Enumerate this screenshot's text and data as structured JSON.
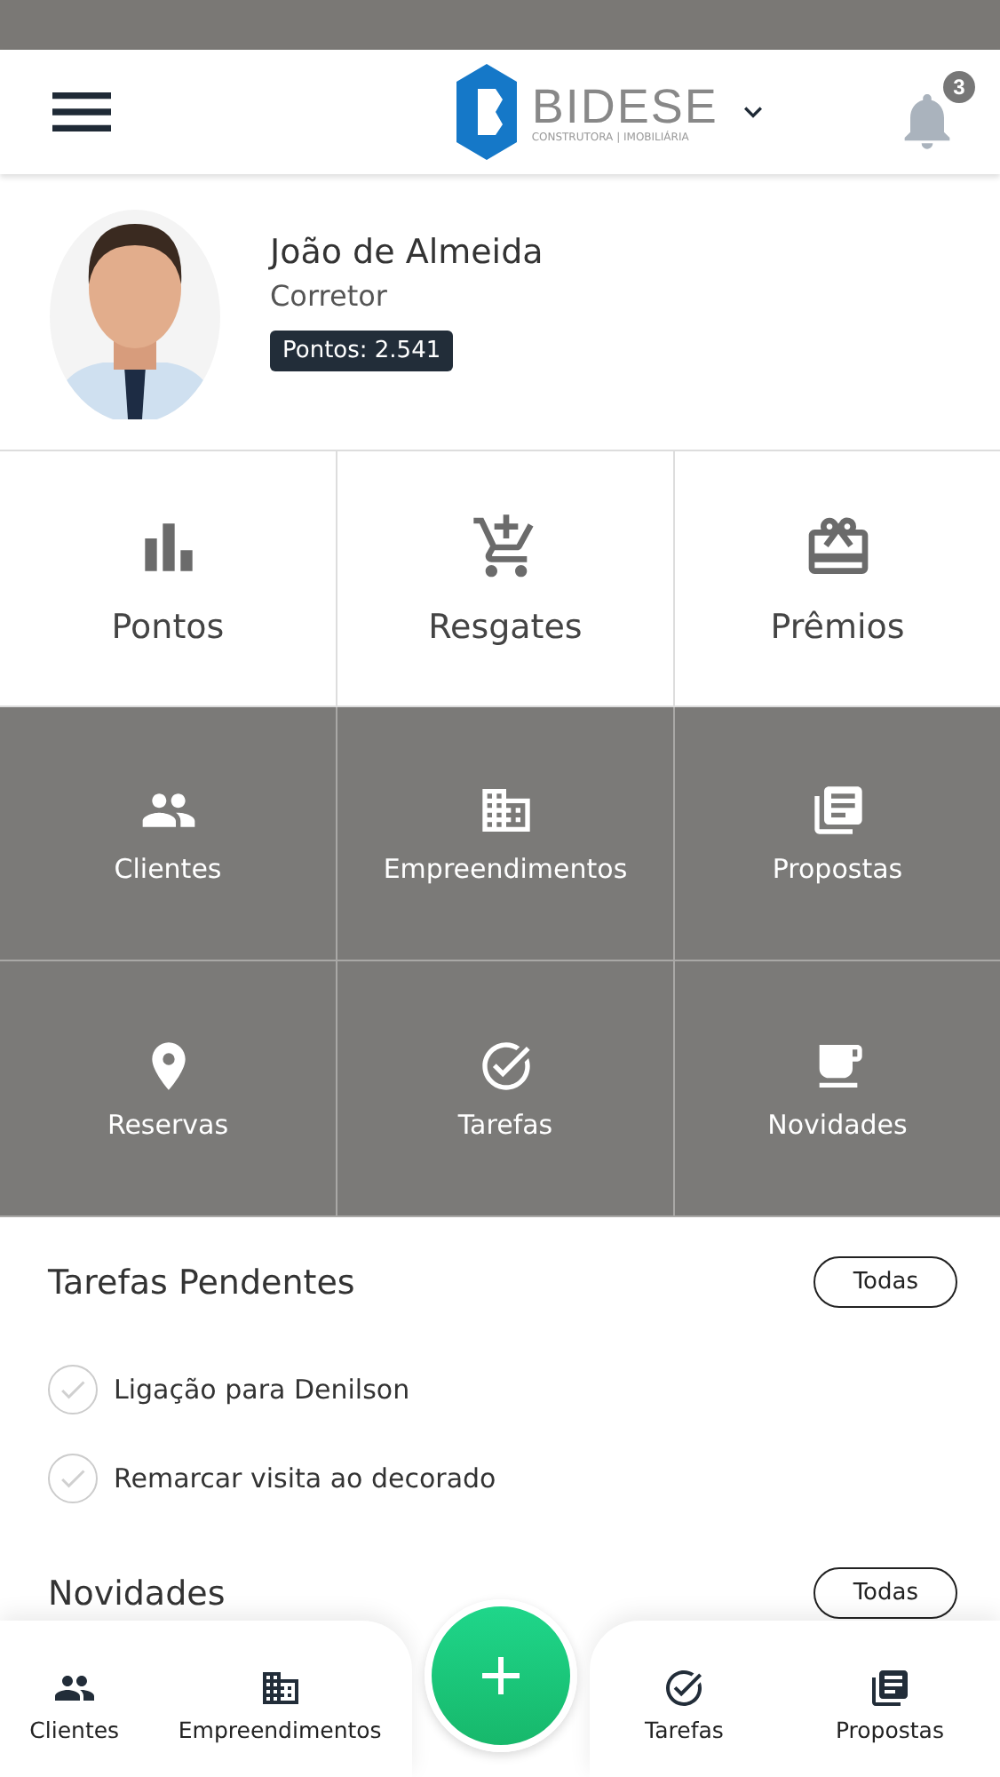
{
  "header": {
    "brand": "BIDESE",
    "brand_subtitle": "CONSTRUTORA | IMOBILIÁRIA",
    "notifications": "3"
  },
  "profile": {
    "name": "João de Almeida",
    "role": "Corretor",
    "points": "Pontos: 2.541"
  },
  "tiles": [
    {
      "label": "Pontos",
      "kind": "light"
    },
    {
      "label": "Resgates",
      "kind": "light"
    },
    {
      "label": "Prêmios",
      "kind": "light"
    },
    {
      "label": "Clientes",
      "kind": "dark"
    },
    {
      "label": "Empreendimentos",
      "kind": "dark"
    },
    {
      "label": "Propostas",
      "kind": "dark"
    },
    {
      "label": "Reservas",
      "kind": "dark"
    },
    {
      "label": "Tarefas",
      "kind": "dark"
    },
    {
      "label": "Novidades",
      "kind": "dark"
    }
  ],
  "tasks_section": {
    "title": "Tarefas Pendentes",
    "button": "Todas",
    "tasks": [
      {
        "text": "Ligação para Denilson",
        "checked": false
      },
      {
        "text": "Remarcar visita ao decorado",
        "checked": false
      }
    ]
  },
  "news_section": {
    "title": "Novidades",
    "button": "Todas"
  },
  "bottom_nav": {
    "left": [
      "Clientes",
      "Empreendimentos"
    ],
    "right": [
      "Tarefas",
      "Propostas"
    ]
  }
}
